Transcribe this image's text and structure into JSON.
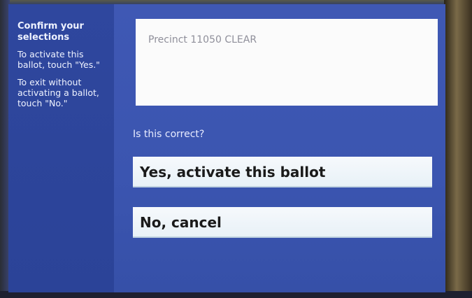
{
  "sidebar": {
    "heading": "Confirm your selections",
    "instruction_yes": "To activate this ballot, touch \"Yes.\"",
    "instruction_no": "To exit without activating a ballot, touch \"No.\""
  },
  "main": {
    "precinct_text": "Precinct 11050 CLEAR",
    "question": "Is this correct?",
    "yes_label": "Yes, activate this ballot",
    "no_label": "No, cancel"
  },
  "colors": {
    "screen_bg": "#3f58b4",
    "sidebar_bg": "#2f479e",
    "button_bg": "#f4f8fb",
    "precinct_box_bg": "#fbfbfb"
  }
}
